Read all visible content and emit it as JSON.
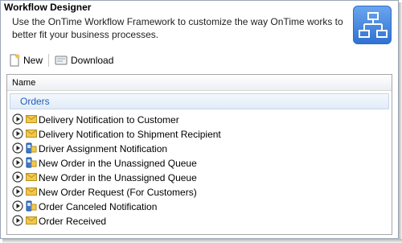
{
  "header": {
    "title": "Workflow Designer",
    "description": "Use the OnTime Workflow Framework to customize the way OnTime works to better fit your business processes."
  },
  "toolbar": {
    "new_label": "New",
    "download_label": "Download"
  },
  "grid": {
    "column_name": "Name",
    "group_label": "Orders",
    "rows": [
      {
        "label": "Delivery Notification to Customer",
        "icon": "envelope-icon"
      },
      {
        "label": "Delivery Notification to Shipment Recipient",
        "icon": "envelope-icon"
      },
      {
        "label": "Driver Assignment Notification",
        "icon": "phone-icon"
      },
      {
        "label": "New Order in the Unassigned Queue",
        "icon": "phone-icon"
      },
      {
        "label": "New Order in the Unassigned Queue",
        "icon": "envelope-icon"
      },
      {
        "label": "New Order Request (For Customers)",
        "icon": "envelope-icon"
      },
      {
        "label": "Order Canceled Notification",
        "icon": "phone-icon"
      },
      {
        "label": "Order Received",
        "icon": "envelope-icon"
      }
    ]
  },
  "colors": {
    "group_text": "#1f5fb8",
    "logo_blue": "#2f72d2",
    "envelope": "#f2c94c"
  }
}
